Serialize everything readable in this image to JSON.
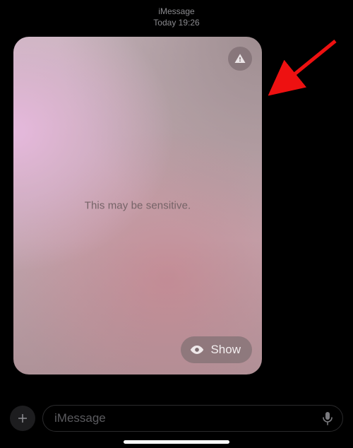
{
  "header": {
    "service": "iMessage",
    "timestamp": "Today 19:26"
  },
  "bubble": {
    "sensitive_label": "This may be sensitive.",
    "show_label": "Show",
    "warning_icon": "warning-triangle-icon",
    "eye_icon": "eye-icon"
  },
  "compose": {
    "placeholder": "iMessage",
    "plus_icon": "plus-icon",
    "mic_icon": "mic-icon"
  },
  "annotation": {
    "arrow_color": "#e11"
  }
}
